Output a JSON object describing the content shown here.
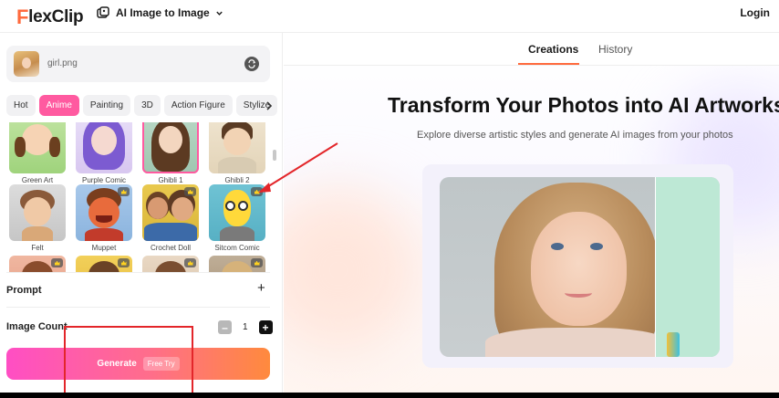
{
  "header": {
    "logo_letter": "F",
    "logo_text": "lexClip",
    "tool_label": "AI Image to Image",
    "login_label": "Login"
  },
  "upload": {
    "file_name": "girl.png"
  },
  "style_tabs": [
    {
      "label": "Hot",
      "active": false
    },
    {
      "label": "Anime",
      "active": true
    },
    {
      "label": "Painting",
      "active": false
    },
    {
      "label": "3D",
      "active": false
    },
    {
      "label": "Action Figure",
      "active": false
    },
    {
      "label": "Stylize",
      "active": false
    }
  ],
  "styles": [
    {
      "name": "Green Art",
      "premium": false
    },
    {
      "name": "Purple Comic",
      "premium": false
    },
    {
      "name": "Ghibli 1",
      "premium": false,
      "selected": true
    },
    {
      "name": "Ghibli 2",
      "premium": false
    },
    {
      "name": "Felt",
      "premium": false
    },
    {
      "name": "Muppet",
      "premium": true
    },
    {
      "name": "Crochet Doll",
      "premium": true
    },
    {
      "name": "Sitcom Comic",
      "premium": true
    }
  ],
  "prompt": {
    "label": "Prompt"
  },
  "image_count": {
    "label": "Image Count",
    "value": "1"
  },
  "generate": {
    "label": "Generate",
    "badge": "Free Try"
  },
  "right_tabs": [
    {
      "label": "Creations",
      "active": true
    },
    {
      "label": "History",
      "active": false
    }
  ],
  "hero": {
    "title": "Transform Your Photos into AI Artworks",
    "subtitle": "Explore diverse artistic styles and generate AI images from your photos"
  },
  "colors": {
    "accent_pink": "#ff5aa0",
    "accent_orange": "#ff6a3d",
    "annotation_red": "#e3262a"
  },
  "icons": {
    "tool_icon": "image-ai-icon",
    "dropdown": "chevron-down-icon",
    "swap": "swap-icon",
    "next": "chevron-right-icon",
    "premium": "crown-icon"
  }
}
